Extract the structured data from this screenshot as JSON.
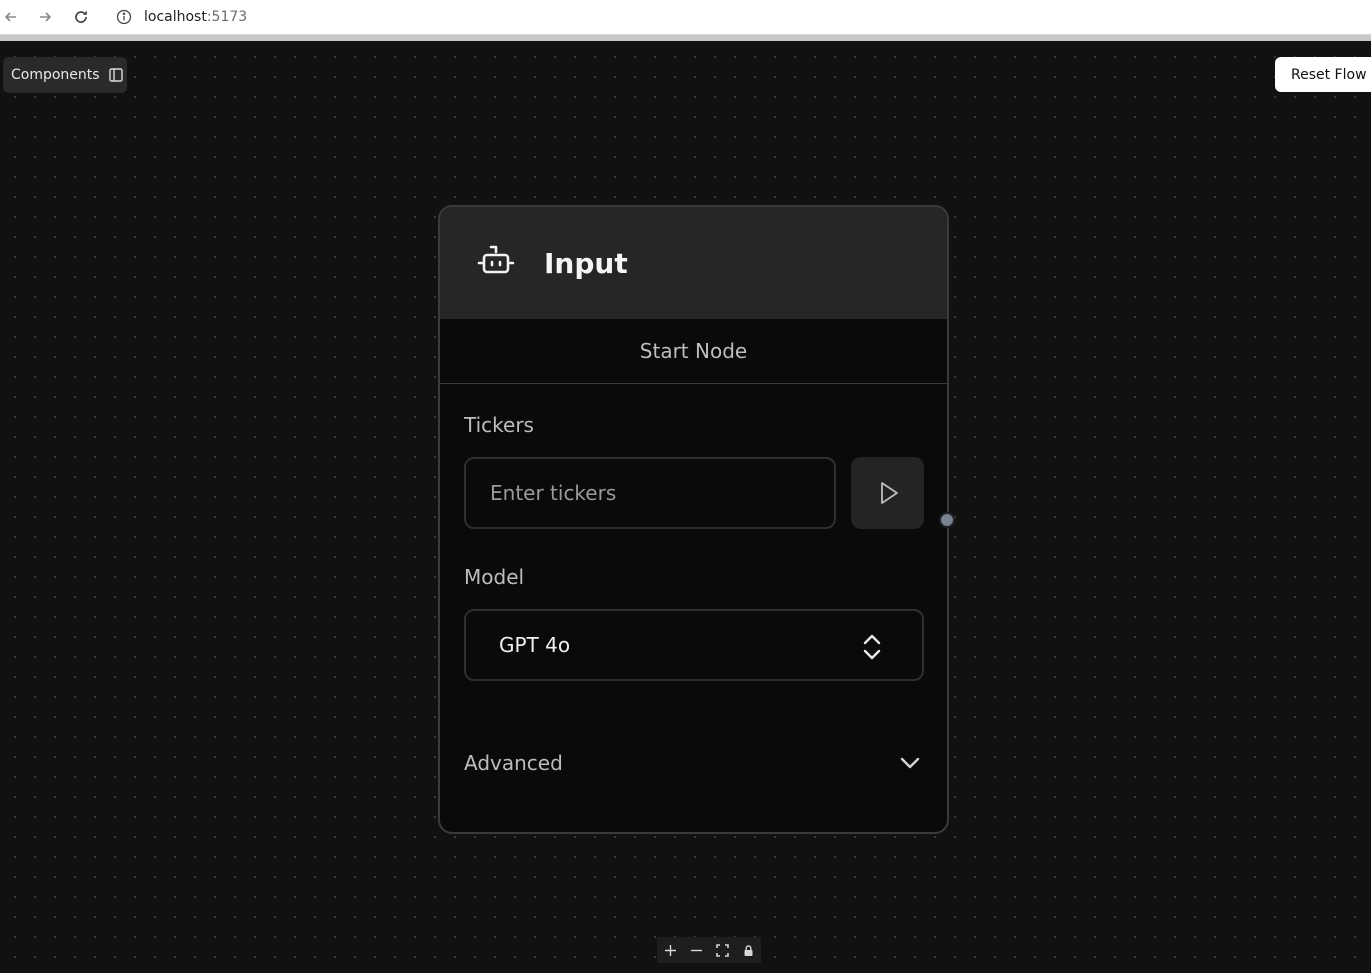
{
  "browser": {
    "url_host": "localhost",
    "url_port": ":5173",
    "icons": [
      "back-arrow-icon",
      "forward-arrow-icon",
      "reload-icon",
      "site-info-icon"
    ]
  },
  "toolbar": {
    "components_label": "Components",
    "components_icon": "sidebar-panel-icon",
    "reset_label": "Reset Flow"
  },
  "node": {
    "icon": "bot-icon",
    "title": "Input",
    "subtitle": "Start Node",
    "tickers_label": "Tickers",
    "tickers_placeholder": "Enter tickers",
    "tickers_value": "",
    "run_icon": "play-icon",
    "model_label": "Model",
    "model_value": "GPT 4o",
    "advanced_label": "Advanced"
  },
  "controls": {
    "icons": [
      "zoom-in-icon",
      "zoom-out-icon",
      "fit-view-icon",
      "lock-icon"
    ]
  },
  "colors": {
    "canvas_bg": "#111111",
    "node_bg": "#0a0a0a",
    "node_header_bg": "#262626",
    "handle": "#7a8290"
  }
}
